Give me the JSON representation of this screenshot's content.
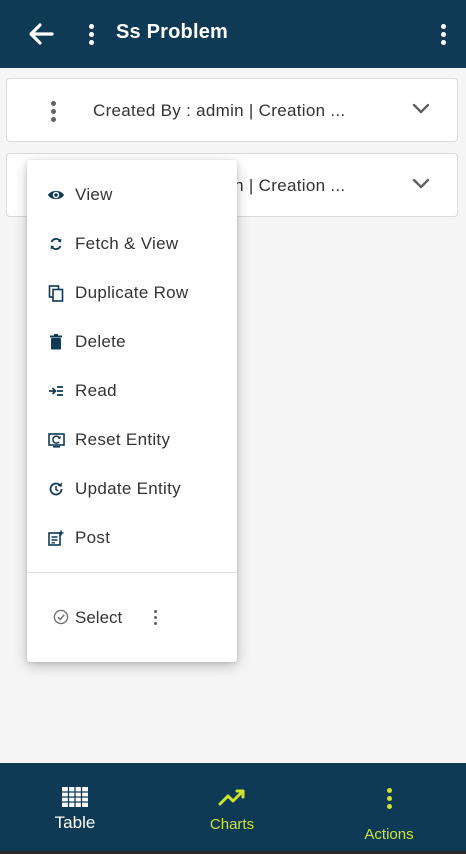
{
  "header": {
    "title": "Ss Problem",
    "back_icon": "arrow-left-icon",
    "left_menu_icon": "more-vertical-icon",
    "right_menu_icon": "more-vertical-icon",
    "background": "#0f3a55"
  },
  "rows": [
    {
      "text": "Created By  : admin | Creation ..."
    },
    {
      "text": "Created By  : admin | Creation ..."
    }
  ],
  "context_menu": {
    "items": [
      {
        "label": "View",
        "icon": "eye-icon"
      },
      {
        "label": "Fetch & View",
        "icon": "refresh-icon"
      },
      {
        "label": "Duplicate Row",
        "icon": "copy-icon"
      },
      {
        "label": "Delete",
        "icon": "trash-icon"
      },
      {
        "label": "Read",
        "icon": "read-icon"
      },
      {
        "label": "Reset Entity",
        "icon": "reset-icon"
      },
      {
        "label": "Update Entity",
        "icon": "update-icon"
      },
      {
        "label": "Post",
        "icon": "post-icon"
      }
    ],
    "select_label": "Select"
  },
  "bottom_nav": {
    "tabs": [
      {
        "label": "Table",
        "icon": "grid-icon"
      },
      {
        "label": "Charts",
        "icon": "line-chart-icon"
      },
      {
        "label": "Actions",
        "icon": "more-vertical-icon"
      }
    ],
    "active_color": "#cde42c",
    "background": "#0f3a55"
  }
}
